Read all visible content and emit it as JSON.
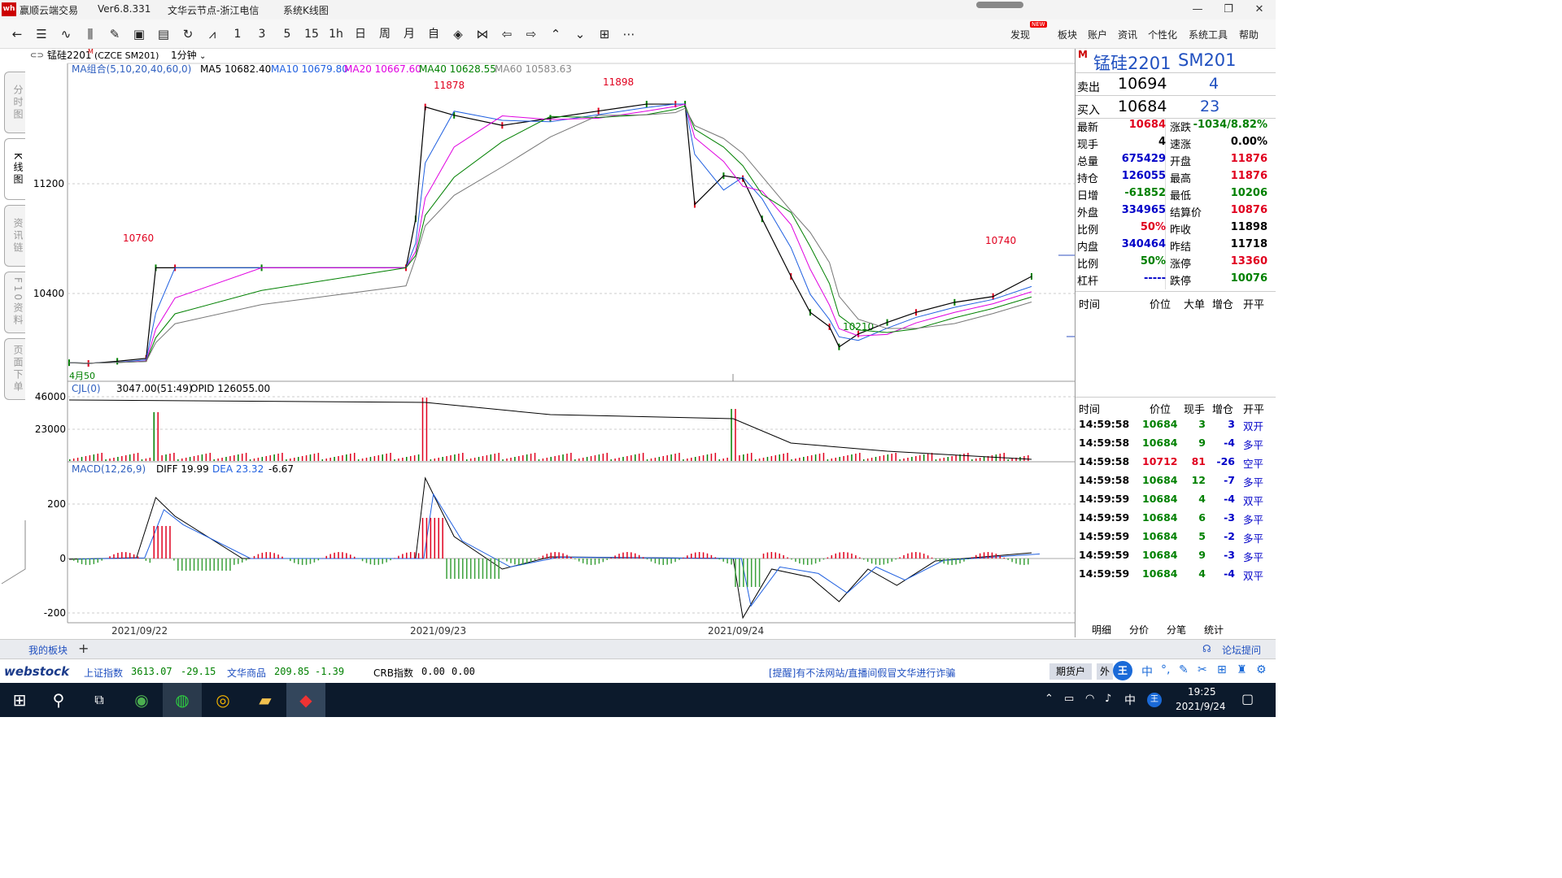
{
  "window": {
    "app_title": "赢顺云端交易",
    "version": "Ver6.8.331",
    "node": "文华云节点-浙江电信",
    "view": "系统K线图"
  },
  "toolbar": {
    "period_buttons": [
      "1",
      "3",
      "5",
      "15",
      "1h",
      "日",
      "周",
      "月",
      "自"
    ],
    "menus": [
      "发现",
      "板块",
      "账户",
      "资讯",
      "个性化",
      "系统工具",
      "帮助"
    ],
    "new_badge": "NEW"
  },
  "left_tabs": [
    "分时图",
    "K线图",
    "资讯链",
    "F10资料",
    "页面下单"
  ],
  "chart_header": {
    "symbol": "锰硅2201",
    "symbol_sup": "M",
    "code": "(CZCE SM201)",
    "period": "1分钟"
  },
  "ma_legend": {
    "label": "MA组合(5,10,20,40,60,0)",
    "ma5": "MA5 10682.40",
    "ma10": "MA10 10679.80",
    "ma20": "MA20 10667.60",
    "ma40": "MA40 10628.55",
    "ma60": "MA60 10583.63"
  },
  "price_annotations": {
    "a1": "10760",
    "a2": "11878",
    "a3": "11898",
    "a4": "10740",
    "a5": "10210",
    "a6": "4月50"
  },
  "price_axis": [
    "11200",
    "10400"
  ],
  "vol_legend": {
    "label": "CJL(0)",
    "v": "3047.00(51:49)",
    "opid": "OPID 126055.00"
  },
  "vol_axis": [
    "46000",
    "23000"
  ],
  "macd_legend": {
    "label": "MACD(12,26,9)",
    "diff": "DIFF 19.99",
    "dea": "DEA 23.32",
    "macd": "-6.67"
  },
  "macd_axis": [
    "200",
    "0",
    "-200"
  ],
  "dates": [
    "2021/09/22",
    "2021/09/23",
    "2021/09/24"
  ],
  "chart_data": {
    "type": "line",
    "title": "锰硅2201 1分钟",
    "price_annotations": [
      {
        "label": "10760",
        "x": "2021/09/22"
      },
      {
        "label": "11878",
        "x": "2021/09/23"
      },
      {
        "label": "11898",
        "x": "2021/09/23"
      },
      {
        "label": "10210",
        "x": "2021/09/24"
      },
      {
        "label": "10740",
        "x": "2021/09/24"
      }
    ],
    "price_series_x": [
      0,
      0.02,
      0.05,
      0.08,
      0.09,
      0.11,
      0.2,
      0.35,
      0.36,
      0.37,
      0.4,
      0.45,
      0.5,
      0.55,
      0.6,
      0.63,
      0.64,
      0.65,
      0.68,
      0.7,
      0.72,
      0.75,
      0.77,
      0.79,
      0.8,
      0.82,
      0.85,
      0.88,
      0.92,
      0.96,
      1.0
    ],
    "price_series": [
      10100,
      10095,
      10110,
      10130,
      10760,
      10760,
      10760,
      10760,
      11100,
      11878,
      11820,
      11750,
      11800,
      11850,
      11898,
      11898,
      11898,
      11200,
      11400,
      11380,
      11100,
      10700,
      10450,
      10350,
      10210,
      10300,
      10380,
      10450,
      10520,
      10560,
      10700
    ],
    "ylim": [
      10050,
      12000
    ]
  },
  "right_panel": {
    "symbol": "锰硅2201",
    "code": "SM201",
    "flag": "M",
    "sell": {
      "label": "卖出",
      "price": "10694",
      "qty": "4"
    },
    "buy": {
      "label": "买入",
      "price": "10684",
      "qty": "23"
    },
    "stats_left": [
      [
        "最新",
        "10684"
      ],
      [
        "现手",
        "4"
      ],
      [
        "总量",
        "675429"
      ],
      [
        "持仓",
        "126055"
      ],
      [
        "日增",
        "-61852"
      ],
      [
        "外盘",
        "334965"
      ],
      [
        "比例",
        "50%"
      ],
      [
        "内盘",
        "340464"
      ],
      [
        "比例",
        "50%"
      ],
      [
        "杠杆",
        "-----"
      ]
    ],
    "stats_right": [
      [
        "涨跌",
        "-1034/8.82%"
      ],
      [
        "速涨",
        "0.00%"
      ],
      [
        "开盘",
        "11876"
      ],
      [
        "最高",
        "11876"
      ],
      [
        "最低",
        "10206"
      ],
      [
        "结算价",
        "10876"
      ],
      [
        "昨收",
        "11898"
      ],
      [
        "昨结",
        "11718"
      ],
      [
        "涨停",
        "13360"
      ],
      [
        "跌停",
        "10076"
      ]
    ],
    "big_hdr": [
      "时间",
      "价位",
      "大单",
      "增仓",
      "开平"
    ],
    "tick_hdr": [
      "时间",
      "价位",
      "现手",
      "增仓",
      "开平"
    ],
    "ticks": [
      [
        "14:59:58",
        "10684",
        "3",
        "3",
        "双开"
      ],
      [
        "14:59:58",
        "10684",
        "9",
        "-4",
        "多平"
      ],
      [
        "14:59:58",
        "10712",
        "81",
        "-26",
        "空平"
      ],
      [
        "14:59:58",
        "10684",
        "12",
        "-7",
        "多平"
      ],
      [
        "14:59:59",
        "10684",
        "4",
        "-4",
        "双平"
      ],
      [
        "14:59:59",
        "10684",
        "6",
        "-3",
        "多平"
      ],
      [
        "14:59:59",
        "10684",
        "5",
        "-2",
        "多平"
      ],
      [
        "14:59:59",
        "10684",
        "9",
        "-3",
        "多平"
      ],
      [
        "14:59:59",
        "10684",
        "4",
        "-4",
        "双平"
      ]
    ],
    "bottom_tabs": [
      "明细",
      "分价",
      "分笔",
      "统计"
    ]
  },
  "block_bar": {
    "my_block": "我的板块",
    "add": "+",
    "forum": "论坛提问"
  },
  "status": {
    "brand": "webstock",
    "idx1_name": "上证指数",
    "idx1_val": "3613.07",
    "idx1_chg": "-29.15",
    "idx2_name": "文华商品",
    "idx2_val": "209.85",
    "idx2_chg": "-1.39",
    "idx3_name": "CRB指数",
    "idx3_val": "0.00",
    "idx3_chg": "0.00",
    "notice": "[提醒]有不法网站/直播间假冒文华进行诈骗",
    "futures_acct": "期货户",
    "wai": "外"
  },
  "taskbar": {
    "time": "19:25",
    "date": "2021/9/24",
    "ime": "中"
  }
}
